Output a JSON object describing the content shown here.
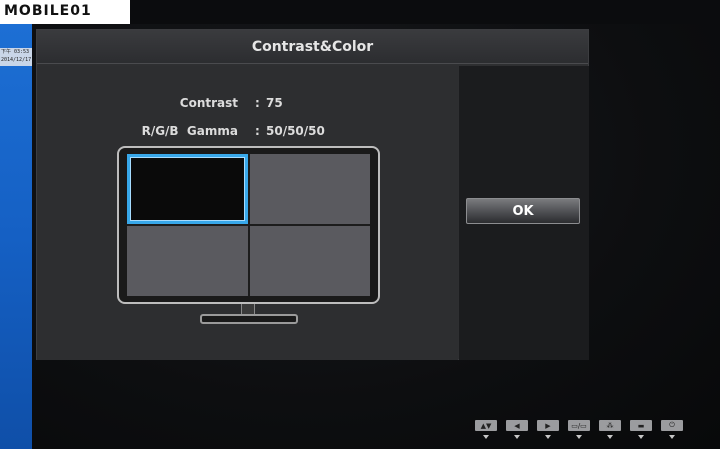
{
  "watermark": {
    "text": "MOBILE01"
  },
  "desktop": {
    "clock_time": "下午 03:53",
    "clock_date": "2014/12/17"
  },
  "osd": {
    "title": "Contrast&Color",
    "rows": [
      {
        "label": "Contrast",
        "value": "75"
      },
      {
        "label": "R/G/B  Gamma",
        "value": "50/50/50"
      }
    ],
    "separator": ":",
    "ok_label": "OK",
    "selected_quadrant": "top-left"
  },
  "colors": {
    "selection_border": "#38a8ea",
    "desktop_blue": "#1560c4"
  },
  "hardware_keys": [
    {
      "name": "up-down-key",
      "glyph": "▲▼"
    },
    {
      "name": "left-key",
      "glyph": "◀"
    },
    {
      "name": "right-key",
      "glyph": "▶"
    },
    {
      "name": "input-key",
      "glyph": "▭/▭"
    },
    {
      "name": "settings-key",
      "glyph": "⁂"
    },
    {
      "name": "menu-key",
      "glyph": "▬"
    },
    {
      "name": "power-key",
      "glyph": "⏻"
    }
  ]
}
